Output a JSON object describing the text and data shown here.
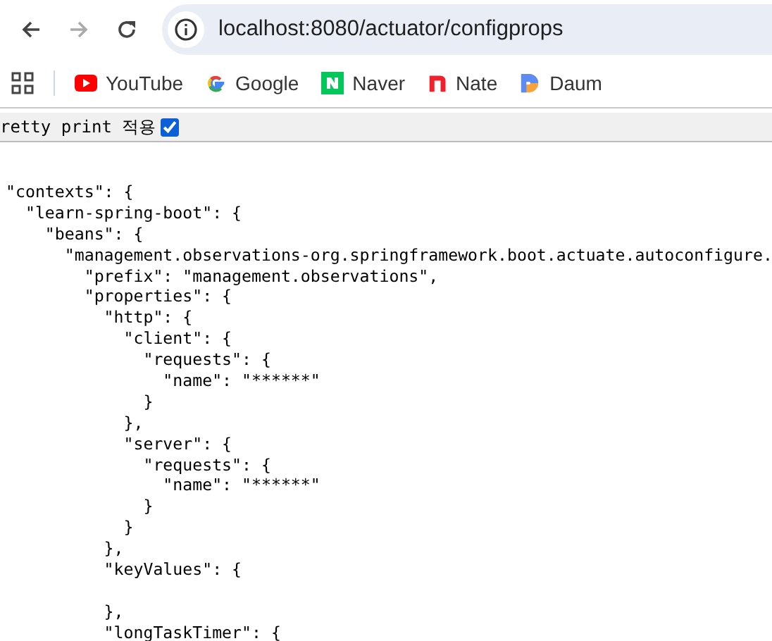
{
  "toolbar": {
    "back": {
      "disabled": false
    },
    "forward": {
      "disabled": true
    },
    "address": "localhost:8080/actuator/configprops"
  },
  "bookmarks": [
    {
      "kind": "youtube",
      "label": "YouTube"
    },
    {
      "kind": "google",
      "label": "Google"
    },
    {
      "kind": "naver",
      "label": "Naver"
    },
    {
      "kind": "nate",
      "label": "Nate"
    },
    {
      "kind": "daum",
      "label": "Daum"
    }
  ],
  "pretty_print": {
    "label": "retty print 적용",
    "checked": true
  },
  "json_lines": [
    {
      "kind": "code",
      "text": "\"contexts\": {"
    },
    {
      "kind": "code",
      "text": "  \"learn-spring-boot\": {"
    },
    {
      "kind": "code",
      "text": "    \"beans\": {"
    },
    {
      "kind": "code",
      "text": "      \"management.observations-org.springframework.boot.actuate.autoconfigure."
    },
    {
      "kind": "code",
      "text": "        \"prefix\": \"management.observations\","
    },
    {
      "kind": "code",
      "text": "        \"properties\": {"
    },
    {
      "kind": "code",
      "text": "          \"http\": {"
    },
    {
      "kind": "code",
      "text": "            \"client\": {"
    },
    {
      "kind": "code",
      "text": "              \"requests\": {"
    },
    {
      "kind": "code",
      "text": "                \"name\": \"******\""
    },
    {
      "kind": "code",
      "text": "              }"
    },
    {
      "kind": "code",
      "text": "            },"
    },
    {
      "kind": "code",
      "text": "            \"server\": {"
    },
    {
      "kind": "code",
      "text": "              \"requests\": {"
    },
    {
      "kind": "code",
      "text": "                \"name\": \"******\""
    },
    {
      "kind": "code",
      "text": "              }"
    },
    {
      "kind": "code",
      "text": "            }"
    },
    {
      "kind": "code",
      "text": "          },"
    },
    {
      "kind": "code",
      "text": "          \"keyValues\": {"
    },
    {
      "kind": "blank"
    },
    {
      "kind": "code",
      "text": "          },"
    },
    {
      "kind": "code",
      "text": "          \"longTaskTimer\": {"
    }
  ]
}
